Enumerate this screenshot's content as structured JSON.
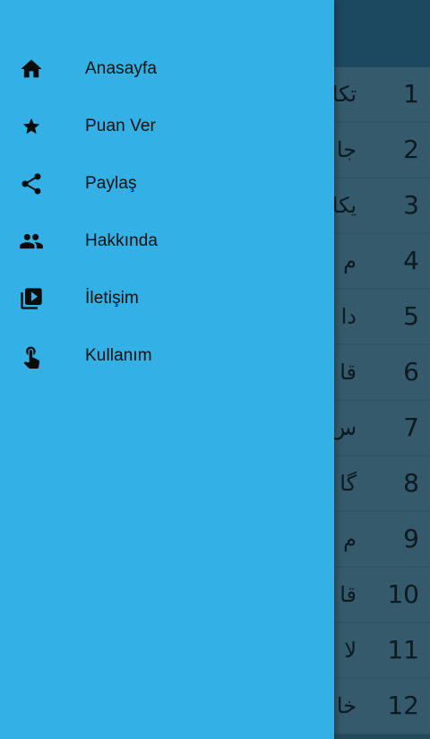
{
  "drawer": {
    "items": [
      {
        "label": "Anasayfa",
        "icon": "home-icon"
      },
      {
        "label": "Puan Ver",
        "icon": "star-icon"
      },
      {
        "label": "Paylaş",
        "icon": "share-icon"
      },
      {
        "label": "Hakkında",
        "icon": "people-icon"
      },
      {
        "label": "İletişim",
        "icon": "video-library-icon"
      },
      {
        "label": "Kullanım",
        "icon": "touch-icon"
      }
    ]
  },
  "list": {
    "rows": [
      {
        "num": "1",
        "text": "تکا"
      },
      {
        "num": "2",
        "text": "جا"
      },
      {
        "num": "3",
        "text": "یکا"
      },
      {
        "num": "4",
        "text": "م"
      },
      {
        "num": "5",
        "text": "دا"
      },
      {
        "num": "6",
        "text": "قا"
      },
      {
        "num": "7",
        "text": "س"
      },
      {
        "num": "8",
        "text": "گا"
      },
      {
        "num": "9",
        "text": "م"
      },
      {
        "num": "10",
        "text": "قا"
      },
      {
        "num": "11",
        "text": "لا"
      },
      {
        "num": "12",
        "text": "خا"
      }
    ]
  },
  "colors": {
    "drawer_bg": "#33b0e6",
    "appbar_bg": "#1d4960",
    "row_bg": "#355a6b"
  }
}
